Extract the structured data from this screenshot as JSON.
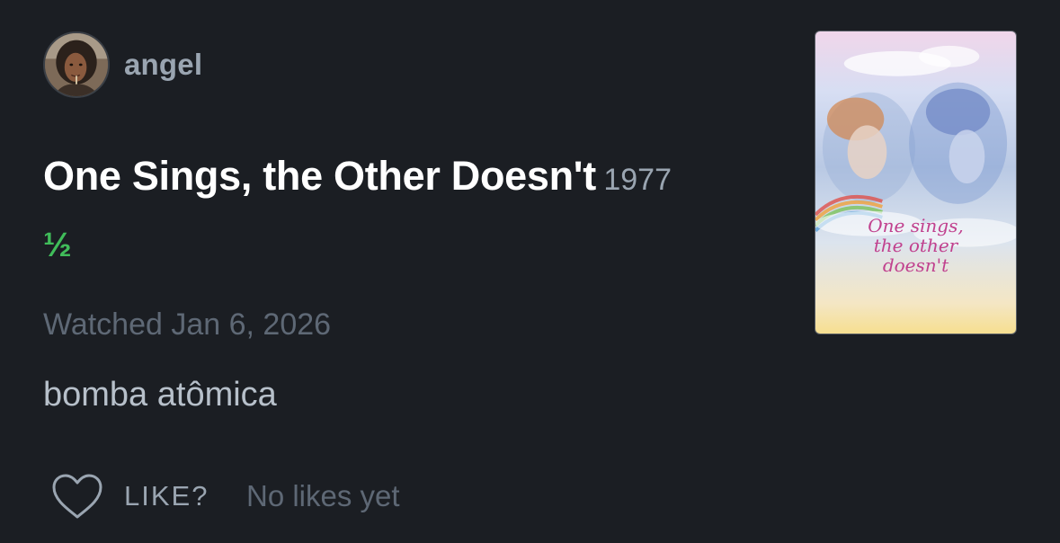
{
  "user": {
    "name": "angel",
    "avatar_icon": "profile-photo"
  },
  "film": {
    "title": "One Sings, the Other Doesn't",
    "year": "1977",
    "rating": "½",
    "poster_text": "One sings,\nthe other\ndoesn't"
  },
  "entry": {
    "watched": "Watched Jan 6, 2026",
    "review": "bomba atômica"
  },
  "actions": {
    "like_label": "LIKE?",
    "like_icon": "heart-outline-icon",
    "likes_count": "No likes yet"
  },
  "colors": {
    "background": "#1b1e23",
    "rating_green": "#40bd5a",
    "muted": "#5e6875",
    "secondary": "#9aa5b1"
  }
}
